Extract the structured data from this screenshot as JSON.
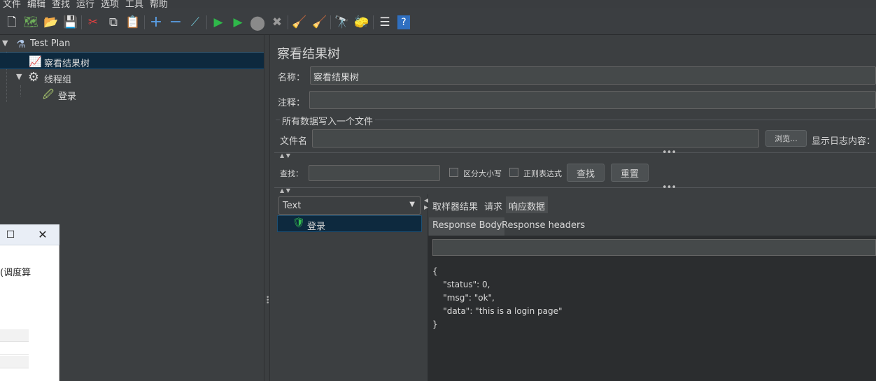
{
  "menubar": {
    "items": [
      "文件",
      "编辑",
      "查找",
      "运行",
      "选项",
      "工具",
      "帮助"
    ]
  },
  "toolbar": {
    "buttons": [
      {
        "name": "new-icon",
        "glyph": "🗋"
      },
      {
        "name": "templates-icon",
        "glyph": "🗺"
      },
      {
        "name": "open-icon",
        "glyph": "📂"
      },
      {
        "name": "save-icon",
        "glyph": "💾"
      },
      {
        "name": "cut-icon",
        "glyph": "✂"
      },
      {
        "name": "copy-icon",
        "glyph": "⧉"
      },
      {
        "name": "paste-icon",
        "glyph": "📋"
      },
      {
        "name": "expand-icon",
        "glyph": "+"
      },
      {
        "name": "collapse-icon",
        "glyph": "−"
      },
      {
        "name": "toggle-icon",
        "glyph": "⟋"
      },
      {
        "name": "start-icon",
        "glyph": "▶"
      },
      {
        "name": "start-no-pause-icon",
        "glyph": "▶"
      },
      {
        "name": "stop-icon",
        "glyph": "⬤"
      },
      {
        "name": "shutdown-icon",
        "glyph": "✖"
      },
      {
        "name": "clear-icon",
        "glyph": "🧹"
      },
      {
        "name": "clear-all-icon",
        "glyph": "🧹"
      },
      {
        "name": "search-icon",
        "glyph": "🔭"
      },
      {
        "name": "reset-search-icon",
        "glyph": "🧽"
      },
      {
        "name": "function-helper-icon",
        "glyph": "☰"
      },
      {
        "name": "help-icon",
        "glyph": "?"
      }
    ]
  },
  "tree": {
    "nodes": [
      {
        "label": "Test Plan"
      },
      {
        "label": "察看结果树"
      },
      {
        "label": "线程组"
      },
      {
        "label": "登录"
      }
    ]
  },
  "overlay": {
    "text": "(调度算",
    "maximize": "☐",
    "close": "✕"
  },
  "main": {
    "title": "察看结果树",
    "name_label": "名称：",
    "name_value": "察看结果树",
    "comment_label": "注释：",
    "comment_value": "",
    "write_all_label": "所有数据写入一个文件",
    "filename_label": "文件名",
    "filename_value": "",
    "browse_button": "浏览...",
    "log_display_label": "显示日志内容：",
    "search_label": "查找：",
    "search_value": "",
    "case_sensitive_label": "区分大小写",
    "regex_label": "正则表达式",
    "find_button": "查找",
    "reset_button": "重置"
  },
  "results": {
    "renderer": "Text",
    "items": [
      {
        "label": "登录",
        "status": "success"
      }
    ],
    "tabs": [
      "取样器结果",
      "请求",
      "响应数据"
    ],
    "active_tab": "响应数据",
    "subtabs": [
      "Response Body",
      "Response headers"
    ],
    "active_subtab": "Response Body",
    "body": "{\n    \"status\": 0,\n    \"msg\": \"ok\",\n    \"data\": \"this is a login page\"\n}"
  },
  "colors": {
    "background": "#3c3f41",
    "selection": "#0d293e",
    "text": "#d6d6d6"
  }
}
